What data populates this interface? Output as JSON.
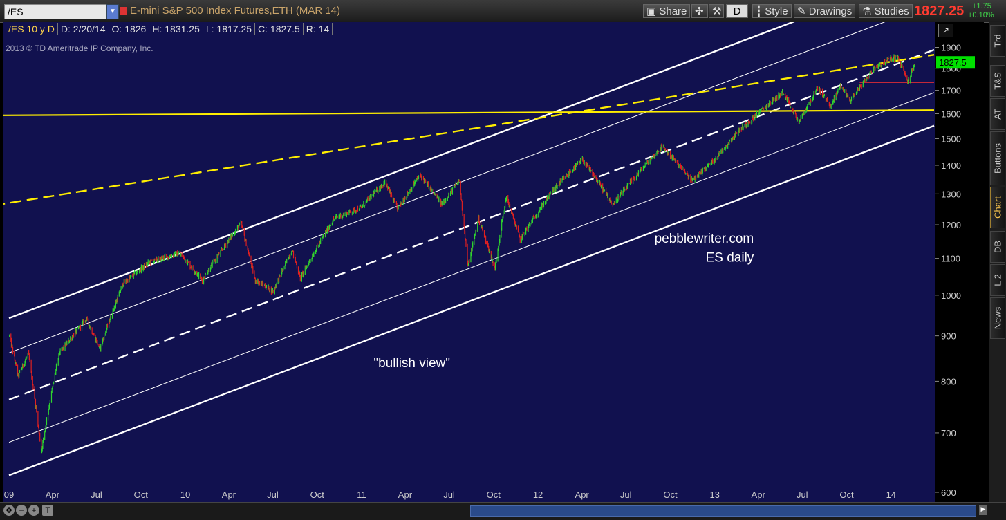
{
  "toolbar": {
    "symbol": "/ES",
    "title": "E-mini S&P 500 Index Futures,ETH (MAR 14)",
    "share_label": "Share",
    "d_label": "D",
    "style_label": "Style",
    "drawings_label": "Drawings",
    "studies_label": "Studies",
    "last_price": "1827.25",
    "change": "+1.75",
    "change_pct": "+0.10%"
  },
  "info": {
    "symbol_period": "/ES 10 y D",
    "date": "D: 2/20/14",
    "open": "O: 1826",
    "high": "H: 1831.25",
    "low": "L: 1817.25",
    "close": "C: 1827.5",
    "range": "R: 14"
  },
  "copyright": "2013 © TD Ameritrade IP Company, Inc.",
  "right_tabs": [
    "Trd",
    "T&S",
    "AT",
    "Buttons",
    "Chart",
    "DB",
    "L 2",
    "News"
  ],
  "colors": {
    "background": "#11114f",
    "up": "#2fd62f",
    "down": "#e02020",
    "channel": "#ffffff",
    "resistance": "#ffee00",
    "price_flag": "#00e000"
  },
  "chart_data": {
    "type": "candlestick",
    "scale": "log",
    "ylim": [
      600,
      1950
    ],
    "yticks": [
      600,
      700,
      800,
      900,
      1000,
      1100,
      1200,
      1300,
      1400,
      1500,
      1600,
      1700,
      1800,
      1900
    ],
    "xrange": [
      "2009-01-01",
      "2014-03-31"
    ],
    "xticks": [
      {
        "label": "09",
        "date": "2009-01-01"
      },
      {
        "label": "Apr",
        "date": "2009-04-01"
      },
      {
        "label": "Jul",
        "date": "2009-07-01"
      },
      {
        "label": "Oct",
        "date": "2009-10-01"
      },
      {
        "label": "10",
        "date": "2010-01-01"
      },
      {
        "label": "Apr",
        "date": "2010-04-01"
      },
      {
        "label": "Jul",
        "date": "2010-07-01"
      },
      {
        "label": "Oct",
        "date": "2010-10-01"
      },
      {
        "label": "11",
        "date": "2011-01-01"
      },
      {
        "label": "Apr",
        "date": "2011-04-01"
      },
      {
        "label": "Jul",
        "date": "2011-07-01"
      },
      {
        "label": "Oct",
        "date": "2011-10-01"
      },
      {
        "label": "12",
        "date": "2012-01-01"
      },
      {
        "label": "Apr",
        "date": "2012-04-01"
      },
      {
        "label": "Jul",
        "date": "2012-07-01"
      },
      {
        "label": "Oct",
        "date": "2012-10-01"
      },
      {
        "label": "13",
        "date": "2013-01-01"
      },
      {
        "label": "Apr",
        "date": "2013-04-01"
      },
      {
        "label": "Jul",
        "date": "2013-07-01"
      },
      {
        "label": "Oct",
        "date": "2013-10-01"
      },
      {
        "label": "14",
        "date": "2014-01-01"
      }
    ],
    "price_path": [
      [
        "2009-01-02",
        900
      ],
      [
        "2009-01-20",
        810
      ],
      [
        "2009-02-10",
        860
      ],
      [
        "2009-03-09",
        667
      ],
      [
        "2009-04-15",
        860
      ],
      [
        "2009-06-10",
        940
      ],
      [
        "2009-07-08",
        870
      ],
      [
        "2009-08-25",
        1030
      ],
      [
        "2009-10-20",
        1090
      ],
      [
        "2009-12-20",
        1115
      ],
      [
        "2010-02-05",
        1040
      ],
      [
        "2010-04-26",
        1205
      ],
      [
        "2010-05-25",
        1040
      ],
      [
        "2010-07-02",
        1010
      ],
      [
        "2010-08-10",
        1125
      ],
      [
        "2010-08-27",
        1045
      ],
      [
        "2010-11-05",
        1220
      ],
      [
        "2010-12-31",
        1255
      ],
      [
        "2011-02-18",
        1340
      ],
      [
        "2011-03-16",
        1250
      ],
      [
        "2011-05-02",
        1365
      ],
      [
        "2011-06-16",
        1265
      ],
      [
        "2011-07-22",
        1345
      ],
      [
        "2011-08-09",
        1075
      ],
      [
        "2011-08-31",
        1220
      ],
      [
        "2011-10-04",
        1070
      ],
      [
        "2011-10-27",
        1290
      ],
      [
        "2011-11-25",
        1155
      ],
      [
        "2012-01-31",
        1310
      ],
      [
        "2012-04-02",
        1420
      ],
      [
        "2012-06-04",
        1265
      ],
      [
        "2012-09-14",
        1470
      ],
      [
        "2012-11-15",
        1345
      ],
      [
        "2012-12-31",
        1420
      ],
      [
        "2013-02-19",
        1530
      ],
      [
        "2013-05-21",
        1690
      ],
      [
        "2013-06-24",
        1565
      ],
      [
        "2013-08-02",
        1710
      ],
      [
        "2013-08-30",
        1630
      ],
      [
        "2013-09-18",
        1725
      ],
      [
        "2013-10-08",
        1655
      ],
      [
        "2013-11-29",
        1805
      ],
      [
        "2013-12-31",
        1845
      ],
      [
        "2014-01-15",
        1850
      ],
      [
        "2014-02-05",
        1737
      ],
      [
        "2014-02-20",
        1827.5
      ]
    ],
    "last_value": "1827.5",
    "support_level": 1735,
    "annotations": [
      {
        "text": "pebblewriter.com",
        "date": "2012-12-10",
        "value": 1145
      },
      {
        "text": "ES daily",
        "date": "2013-02-01",
        "value": 1090
      },
      {
        "text": "\"bullish view\"",
        "date": "2011-04-15",
        "value": 830
      }
    ],
    "trendlines": [
      {
        "style": "solid-thick",
        "color": "white",
        "from": [
          "2009-01-01",
          942
        ],
        "to": [
          "2014-03-31",
          2330
        ]
      },
      {
        "style": "solid-thin",
        "color": "white",
        "from": [
          "2009-01-01",
          861
        ],
        "to": [
          "2014-03-31",
          2130
        ]
      },
      {
        "style": "dashed",
        "color": "white",
        "from": [
          "2009-01-01",
          763
        ],
        "to": [
          "2014-03-31",
          1888
        ]
      },
      {
        "style": "solid-thin",
        "color": "white",
        "from": [
          "2009-01-01",
          683
        ],
        "to": [
          "2014-03-31",
          1690
        ]
      },
      {
        "style": "solid-thick",
        "color": "white",
        "from": [
          "2009-01-01",
          627
        ],
        "to": [
          "2014-03-31",
          1551
        ]
      },
      {
        "style": "dashed",
        "color": "yellow",
        "from": [
          "2008-12-01",
          1262
        ],
        "to": [
          "2014-03-31",
          1864
        ]
      },
      {
        "style": "solid",
        "color": "yellow",
        "from": [
          "2008-12-01",
          1593
        ],
        "to": [
          "2014-03-31",
          1615
        ]
      }
    ]
  }
}
